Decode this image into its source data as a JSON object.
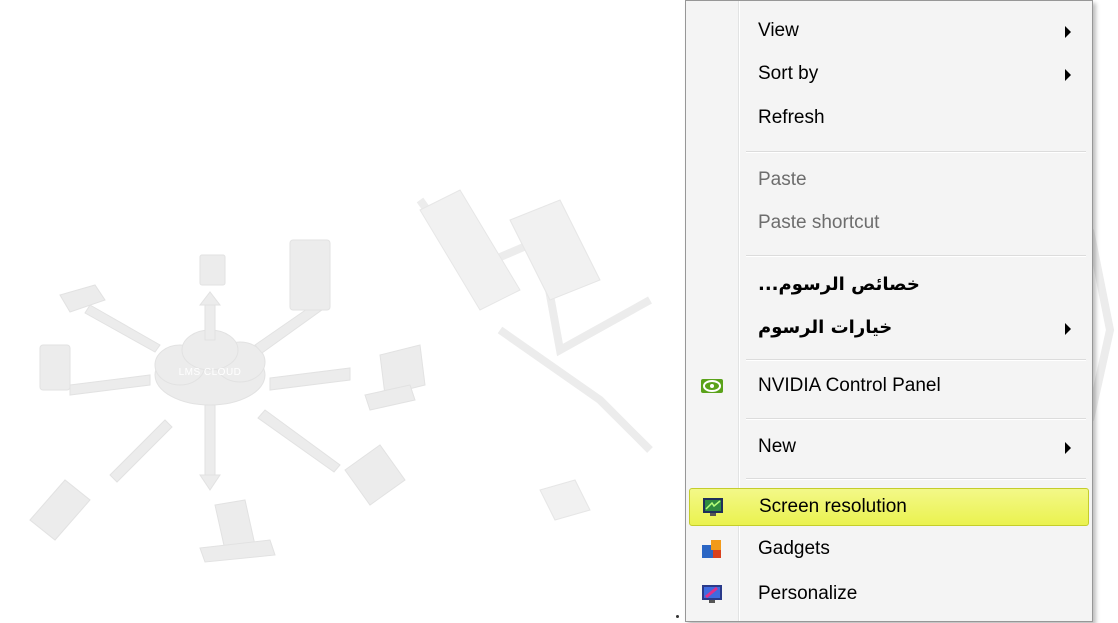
{
  "background": {
    "cloud_label": "LMS CLOUD"
  },
  "menu": {
    "items": [
      {
        "label": "View",
        "submenu": true
      },
      {
        "label": "Sort by",
        "submenu": true
      },
      {
        "label": "Refresh",
        "submenu": false
      },
      {
        "label": "Paste",
        "disabled": true
      },
      {
        "label": "Paste shortcut",
        "disabled": true
      },
      {
        "label": "...خصائص الرسوم",
        "submenu": false
      },
      {
        "label": "خيارات الرسوم",
        "submenu": true
      },
      {
        "label": "NVIDIA Control Panel",
        "icon": "nvidia-icon"
      },
      {
        "label": "New",
        "submenu": true
      },
      {
        "label": "Screen resolution",
        "icon": "screen-resolution-icon",
        "highlighted": true
      },
      {
        "label": "Gadgets",
        "icon": "gadgets-icon"
      },
      {
        "label": "Personalize",
        "icon": "personalize-icon"
      }
    ]
  },
  "colors": {
    "highlight": "#eef46a",
    "menu_bg": "#f4f4f4",
    "disabled_text": "#6d6d6d"
  }
}
